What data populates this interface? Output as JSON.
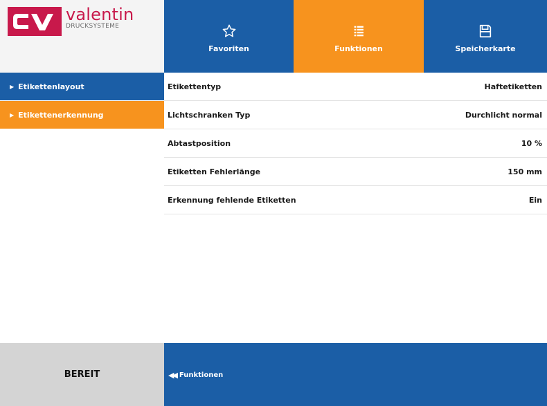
{
  "logo": {
    "mark": "CV",
    "name": "valentin",
    "subtitle": "DRUCKSYSTEME",
    "brand_color": "#c8194b"
  },
  "tabs": [
    {
      "label": "Favoriten",
      "icon": "star-icon",
      "active": false
    },
    {
      "label": "Funktionen",
      "icon": "list-icon",
      "active": true
    },
    {
      "label": "Speicherkarte",
      "icon": "save-icon",
      "active": false
    }
  ],
  "sidebar": {
    "items": [
      {
        "label": "Etikettenlayout",
        "active": false
      },
      {
        "label": "Etikettenerkennung",
        "active": true
      }
    ]
  },
  "settings": [
    {
      "label": "Etikettentyp",
      "value": "Haftetiketten"
    },
    {
      "label": "Lichtschranken Typ",
      "value": "Durchlicht normal"
    },
    {
      "label": "Abtastposition",
      "value": "10 %"
    },
    {
      "label": "Etiketten Fehlerlänge",
      "value": "150 mm"
    },
    {
      "label": "Erkennung fehlende Etiketten",
      "value": "Ein"
    }
  ],
  "status": {
    "text": "BEREIT"
  },
  "footer": {
    "back_label": "Funktionen"
  },
  "colors": {
    "primary": "#1b5ea6",
    "accent": "#f7931e",
    "status_bg": "#d4d4d4"
  }
}
